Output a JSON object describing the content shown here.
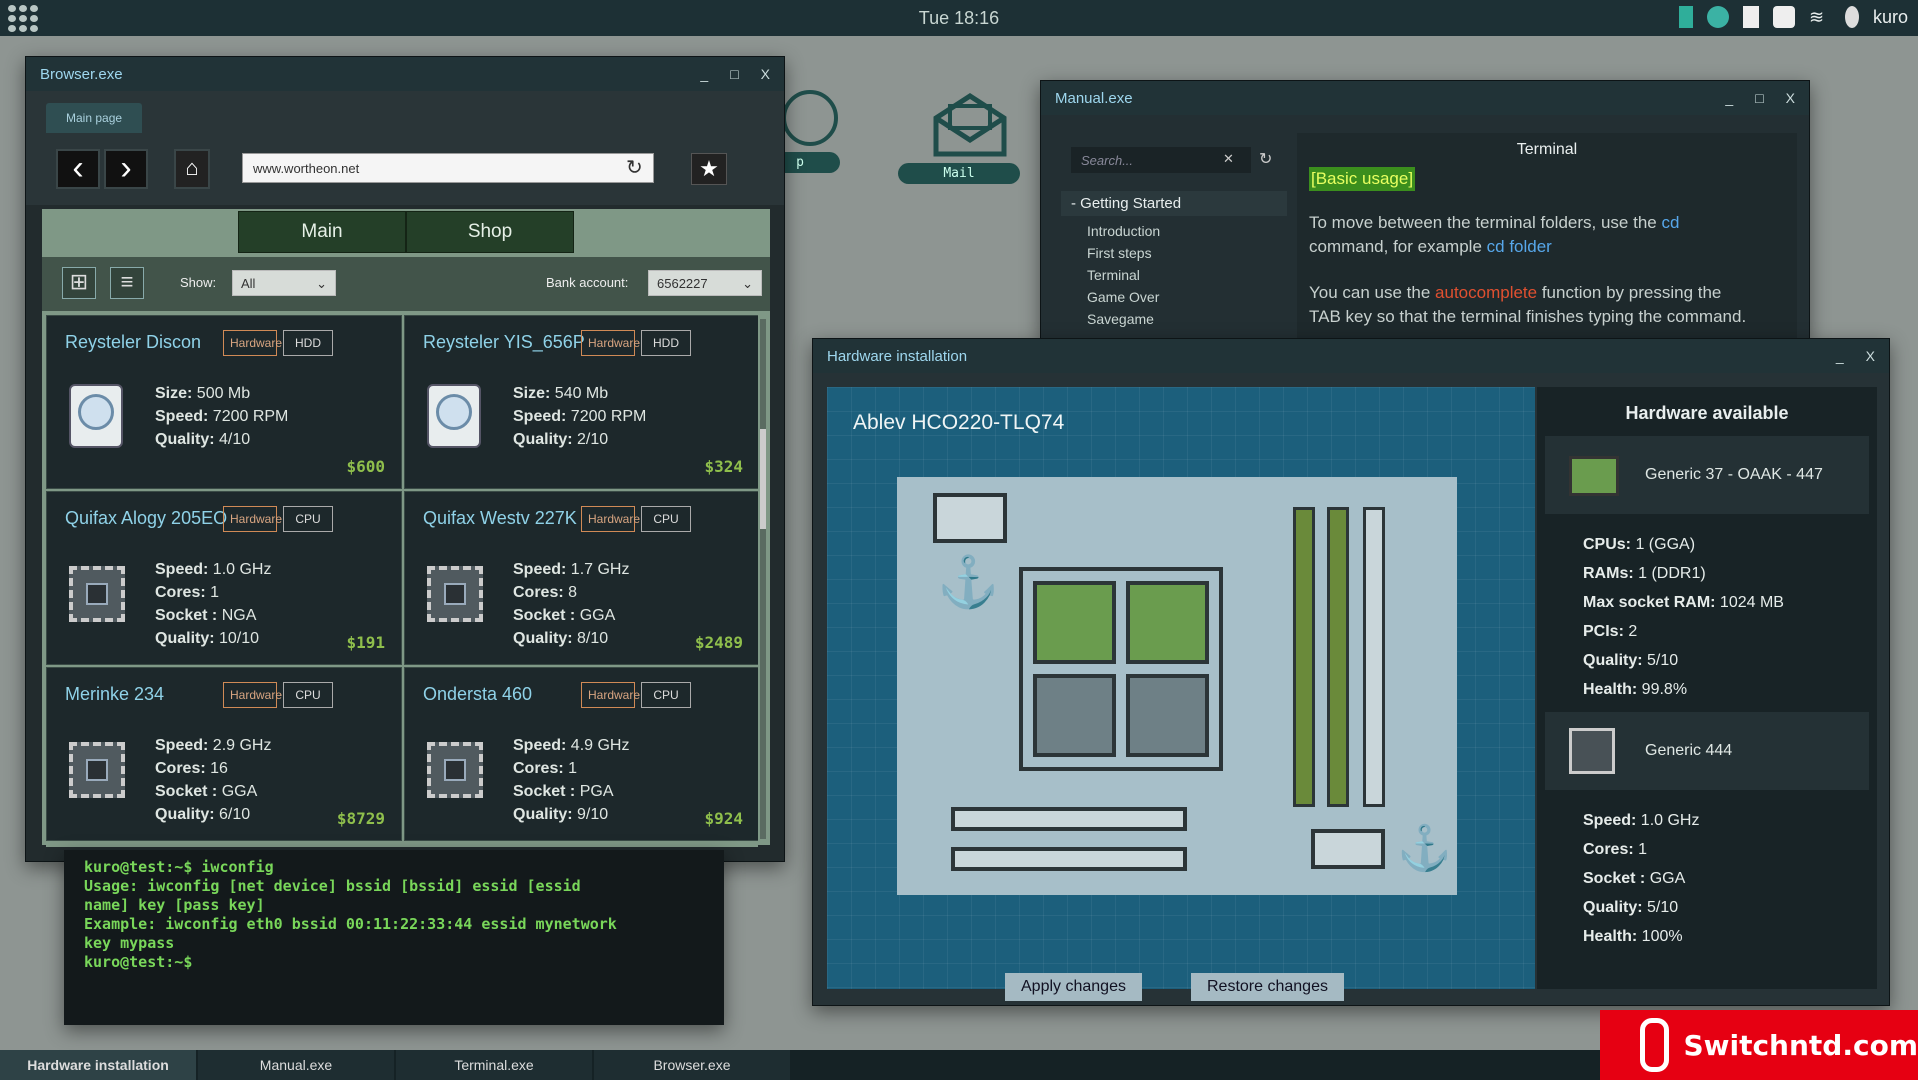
{
  "topbar": {
    "clock": "Tue 18:16",
    "user": "kuro"
  },
  "desktop": {
    "mail_label": "Mail",
    "partial_label": "p"
  },
  "browser": {
    "title": "Browser.exe",
    "tab": "Main page",
    "url": "www.wortheon.net",
    "tabs": [
      "Main",
      "Shop"
    ],
    "show_label": "Show:",
    "show_value": "All",
    "bank_label": "Bank account:",
    "bank_value": "6562227",
    "products": [
      {
        "name": "Reysteler Discon",
        "tag1": "Hardware",
        "tag2": "HDD",
        "icon": "hdd-icon",
        "s1": "Size:",
        "v1": " 500 Mb",
        "s2": "Speed:",
        "v2": " 7200 RPM",
        "s3": "Quality:",
        "v3": " 4/10",
        "s4": "",
        "v4": "",
        "price": "$600"
      },
      {
        "name": "Reysteler YIS_656P",
        "tag1": "Hardware",
        "tag2": "HDD",
        "icon": "hdd-icon",
        "s1": "Size:",
        "v1": " 540 Mb",
        "s2": "Speed:",
        "v2": " 7200 RPM",
        "s3": "Quality:",
        "v3": " 2/10",
        "s4": "",
        "v4": "",
        "price": "$324"
      },
      {
        "name": "Quifax Alogy 205EO",
        "tag1": "Hardware",
        "tag2": "CPU",
        "icon": "cpu-icon",
        "s1": "Speed:",
        "v1": " 1.0 GHz",
        "s2": "Cores:",
        "v2": " 1",
        "s3": "Socket :",
        "v3": " NGA",
        "s4": "Quality:",
        "v4": " 10/10",
        "price": "$191"
      },
      {
        "name": "Quifax Westv 227K",
        "tag1": "Hardware",
        "tag2": "CPU",
        "icon": "cpu-icon",
        "s1": "Speed:",
        "v1": " 1.7 GHz",
        "s2": "Cores:",
        "v2": " 8",
        "s3": "Socket :",
        "v3": " GGA",
        "s4": "Quality:",
        "v4": " 8/10",
        "price": "$2489"
      },
      {
        "name": "Merinke 234",
        "tag1": "Hardware",
        "tag2": "CPU",
        "icon": "cpu-icon",
        "s1": "Speed:",
        "v1": " 2.9 GHz",
        "s2": "Cores:",
        "v2": " 16",
        "s3": "Socket :",
        "v3": " GGA",
        "s4": "Quality:",
        "v4": " 6/10",
        "price": "$8729"
      },
      {
        "name": "Ondersta 460",
        "tag1": "Hardware",
        "tag2": "CPU",
        "icon": "cpu-icon",
        "s1": "Speed:",
        "v1": " 4.9 GHz",
        "s2": "Cores:",
        "v2": " 1",
        "s3": "Socket :",
        "v3": " PGA",
        "s4": "Quality:",
        "v4": " 9/10",
        "price": "$924"
      }
    ]
  },
  "terminal": {
    "lines": "kuro@test:~$ iwconfig\nUsage: iwconfig [net device] bssid [bssid] essid [essid\nname] key [pass key]\nExample: iwconfig eth0 bssid 00:11:22:33:44 essid mynetwork\nkey mypass\nkuro@test:~$"
  },
  "manual": {
    "title": "Manual.exe",
    "search_placeholder": "Search...",
    "section": "Getting Started",
    "items": [
      "Introduction",
      "First steps",
      "Terminal",
      "Game Over",
      "Savegame"
    ],
    "content_title": "Terminal",
    "badge": "[Basic usage]",
    "p1a": "To move between the terminal folders, use the ",
    "p1b": "cd",
    "p1c": " command, for example ",
    "p1d": "cd folder",
    ".": ".",
    "p2a": "You can use the ",
    "p2b": "autocomplete",
    "p2c": " function by pressing the ",
    "p2d": "TAB key so that the terminal finishes typing the command."
  },
  "hardware": {
    "title": "Hardware installation",
    "board_name": "Ablev HCO220-TLQ74",
    "apply": "Apply changes",
    "restore": "Restore changes",
    "side_title": "Hardware available",
    "item1": {
      "name": "Generic 37 - OAAK - 447",
      "lines": [
        [
          "CPUs:",
          " 1 (GGA)"
        ],
        [
          "RAMs:",
          " 1 (DDR1)"
        ],
        [
          "Max socket RAM:",
          " 1024 MB"
        ],
        [
          "PCIs:",
          " 2"
        ],
        [
          "Quality:",
          " 5/10"
        ],
        [
          "Health:",
          " 99.8%"
        ]
      ]
    },
    "item2": {
      "name": "Generic 444",
      "lines": [
        [
          "Speed:",
          " 1.0 GHz"
        ],
        [
          "Cores:",
          " 1"
        ],
        [
          "Socket :",
          " GGA"
        ],
        [
          "Quality:",
          " 5/10"
        ],
        [
          "Health:",
          " 100%"
        ]
      ]
    }
  },
  "taskbar": [
    "Hardware installation",
    "Manual.exe",
    "Terminal.exe",
    "Browser.exe"
  ],
  "watermark": "Switchntd.com"
}
